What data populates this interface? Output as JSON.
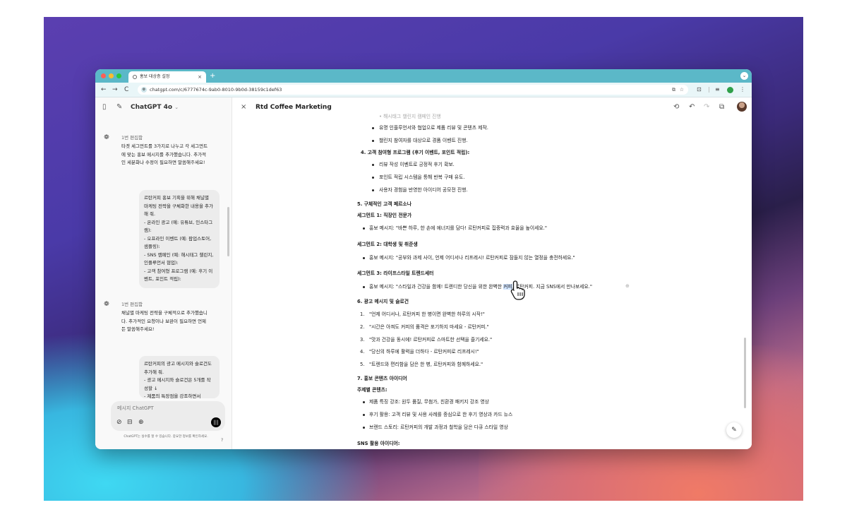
{
  "colors": {
    "tabbar": "#5bb8c8",
    "addressbar": "#e9f6f8",
    "sidebar": "#f9f9f9",
    "bubble": "#ececec",
    "accent_green": "#2fa04a"
  },
  "browser": {
    "tab_title": "홍보 대상층 설정",
    "tab_close": "×",
    "new_tab": "+",
    "url": "chatgpt.com/c/6777674c-9ab0-8010-9b0d-38159c1def63",
    "nav": {
      "back": "←",
      "forward": "→",
      "reload": "C"
    },
    "icons": [
      "share-icon",
      "star-icon",
      "extension-icon",
      "menu-icon"
    ]
  },
  "sidebar": {
    "model_name": "ChatGPT 4o",
    "messages": [
      {
        "type": "ai",
        "label": "1번 편집함",
        "text": "타겟 세그먼트를 3가지로 나누고 각 세그먼트에 맞는 홍보 메시지를 추가했습니다. 추가적인 세분화나 수정이 필요하면 말씀해주세요!"
      },
      {
        "type": "user",
        "text": "르탄커피 홍보 기획을 위해 채널별 마케팅 전략을 구체화한 내용을 추가해 줘.\n- 온라인 광고 (예: 유튜브, 인스타그램):\n- 오프라인 이벤트 (예: 팝업스토어, 샘플링):\n- SNS 캠페인 (예: 해시태그 챌린지, 인플루언서 협업):\n- 고객 참여형 프로그램 (예: 후기 이벤트, 포인트 적립):"
      },
      {
        "type": "ai",
        "label": "1번 편집함",
        "text": "채널별 마케팅 전략을 구체적으로 추가했습니다. 추가적인 요청이나 보완이 필요하면 언제든 말씀해주세요!"
      },
      {
        "type": "user",
        "text": "르탄커피의 광고 메시지와 슬로건도 추가해 줘.\n- 광고 메시지와 슬로건은 5개를 작성할 ↓\n- 제품의 특장점을 강조하면서"
      }
    ],
    "composer_placeholder": "메시지 ChatGPT",
    "disclaimer": "ChatGPT는 실수를 할 수 있습니다. 중요한 정보를 확인하세요.",
    "help": "?"
  },
  "main": {
    "title": "Rtd Coffee Marketing",
    "close": "×",
    "doc": {
      "top_partial": "• 해시태그 챌린지 캠페인 진행",
      "b1": "유명 인플루언서와 협업으로 제품 리뷰 및 콘텐츠 제작.",
      "b2": "챌린지 참여자를 대상으로 경품 이벤트 진행.",
      "s4": "4.  고객 참여형 프로그램 (후기 이벤트, 포인트 적립):",
      "b3": "리뷰 작성 이벤트로 긍정적 후기 확보.",
      "b4": "포인트 적립 시스템을 통해 반복 구매 유도.",
      "b5": "사용자 경험을 반영한 아이디어 공모전 진행.",
      "h5": "5. 구체적인 고객 페르소나",
      "seg1": "세그먼트 1: 직장인 전문가",
      "seg1_msg": "홍보 메시지: \"바쁜 하루, 한 손에 에너지를 담다! 르탄커피로 집중력과 효율을 높이세요.\"",
      "seg2": "세그먼트 2: 대학생 및 취준생",
      "seg2_msg": "홍보 메시지: \"공부와 과제 사이, 언제 어디서나 리프레시! 르탄커피로 잠들지 않는 열정을 충전하세요.\"",
      "seg3": "세그먼트 3: 라이프스타일 트렌드세터",
      "seg3_msg_a": "홍보 메시지: \"스타일과 건강을 함께! 트렌디한 당신을 위한 완벽한 ",
      "seg3_msg_hl": "커피",
      "seg3_msg_b": ", 르탄커피. 지금 SNS에서 만나보세요.\"",
      "h6": "6. 광고 메시지 및 슬로건",
      "slogans": [
        "\"언제 어디서나, 르탄커피 한 병이면 완벽한 하루의 시작!\"",
        "\"시간은 아껴도 커피의 품격은 포기하지 마세요 - 르탄커피.\"",
        "\"맛과 건강을 동시에! 르탄커피로 스마트한 선택을 즐기세요.\"",
        "\"당신의 하루에 활력을 더하다 - 르탄커피로 리프레시!\"",
        "\"트렌드와 편리함을 담은 한 병, 르탄커피와 함께하세요.\""
      ],
      "h7": "7. 홍보 콘텐츠 아이디어",
      "sub7": "주제별 콘텐츠:",
      "c1": "제품 특징 강조: 원두 품질, 무첨가, 친환경 패키지 강조 영상",
      "c2": "후기 활용: 고객 리뷰 및 사용 사례를 중심으로 한 후기 영상과 카드 뉴스",
      "c3": "브랜드 스토리: 르탄커피의 개발 과정과 철학을 담은 다큐 스타일 영상",
      "sns": "SNS 활용 아이디어:"
    }
  }
}
